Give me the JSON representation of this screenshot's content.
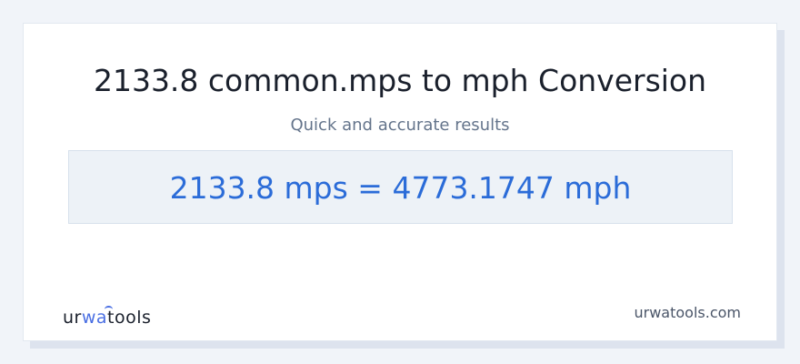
{
  "page": {
    "title": "2133.8 common.mps to mph Conversion",
    "subtitle": "Quick and accurate results",
    "result": "2133.8 mps = 4773.1747 mph"
  },
  "footer": {
    "logo_prefix": "ur",
    "logo_highlight": "wa",
    "logo_suffix": "tools",
    "site": "urwatools.com"
  },
  "colors": {
    "background": "#f1f4f9",
    "card": "#ffffff",
    "title": "#1a202c",
    "subtitle": "#64748b",
    "result_box": "#edf2f7",
    "result_text": "#2b6cd8",
    "logo_accent": "#4a6fe3"
  }
}
